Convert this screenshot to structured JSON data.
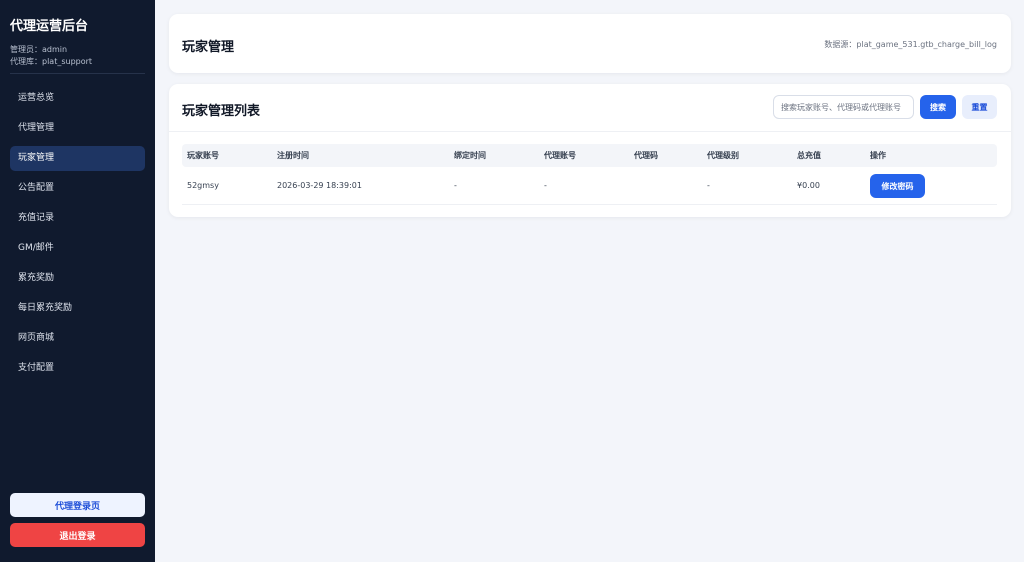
{
  "sidebar": {
    "brand": "代理运营后台",
    "admin_line": "管理员：admin",
    "db_line": "代理库：plat_support",
    "items": [
      {
        "label": "运营总览"
      },
      {
        "label": "代理管理"
      },
      {
        "label": "玩家管理",
        "active": true
      },
      {
        "label": "公告配置"
      },
      {
        "label": "充值记录"
      },
      {
        "label": "GM/邮件"
      },
      {
        "label": "累充奖励"
      },
      {
        "label": "每日累充奖励"
      },
      {
        "label": "网页商城"
      },
      {
        "label": "支付配置"
      }
    ],
    "agent_login_label": "代理登录页",
    "logout_label": "退出登录"
  },
  "header": {
    "title": "玩家管理",
    "datasource": "数据源：plat_game_531.gtb_charge_bill_log"
  },
  "list": {
    "title": "玩家管理列表",
    "search_placeholder": "搜索玩家账号、代理码或代理账号",
    "search_label": "搜索",
    "reset_label": "重置",
    "columns": [
      "玩家账号",
      "注册时间",
      "绑定时间",
      "代理账号",
      "代理码",
      "代理级别",
      "总充值",
      "操作"
    ],
    "rows": [
      {
        "player": "52gmsy",
        "registered": "2026-03-29 18:39:01",
        "bound": "-",
        "agent_account": "-",
        "agent_code": "",
        "agent_level": "-",
        "total_recharge": "¥0.00",
        "action_label": "修改密码"
      }
    ]
  },
  "colors": {
    "sidebar_bg": "#101a2e",
    "active_item": "#1e3563",
    "primary": "#2563eb",
    "danger": "#ef4444",
    "page_bg": "#f3f5fa"
  }
}
